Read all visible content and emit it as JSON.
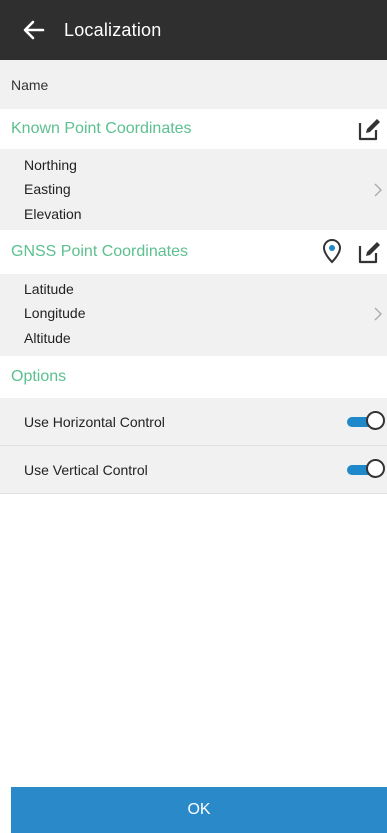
{
  "app_bar": {
    "title": "Localization",
    "back_icon": "arrow-left-icon"
  },
  "name_row": {
    "label": "Name"
  },
  "known_point": {
    "title": "Known Point Coordinates",
    "edit_icon": "edit-icon",
    "fields": [
      "Northing",
      "Easting",
      "Elevation"
    ]
  },
  "gnss_point": {
    "title": "GNSS Point Coordinates",
    "location_icon": "location-pin-icon",
    "edit_icon": "edit-icon",
    "fields": [
      "Latitude",
      "Longitude",
      "Altitude"
    ]
  },
  "options": {
    "title": "Options",
    "items": [
      {
        "label": "Use Horizontal Control",
        "enabled": true
      },
      {
        "label": "Use Vertical Control",
        "enabled": true
      }
    ]
  },
  "footer": {
    "ok_label": "OK"
  },
  "colors": {
    "accent_green": "#5cc08f",
    "primary_blue": "#2a89c9",
    "app_bar": "#2f2f2f",
    "row_background": "#f1f1f1"
  }
}
